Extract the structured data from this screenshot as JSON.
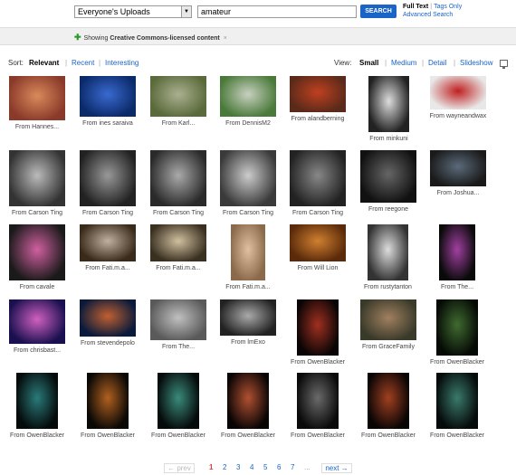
{
  "search": {
    "scope_value": "Everyone's Uploads",
    "query": "amateur",
    "button_label": "SEARCH",
    "mode_full": "Full Text",
    "mode_tags": "Tags Only",
    "advanced": "Advanced Search"
  },
  "cc": {
    "prefix": "Showing",
    "bold": "Creative Commons-licensed content",
    "close": "×"
  },
  "sort": {
    "label": "Sort:",
    "options": [
      "Relevant",
      "Recent",
      "Interesting"
    ]
  },
  "view": {
    "label": "View:",
    "options": [
      "Small",
      "Medium",
      "Detail",
      "Slideshow"
    ]
  },
  "thumbs": [
    {
      "cap": "From Hannes...",
      "c1": "#8a3a2a",
      "c2": "#d98a5a"
    },
    {
      "cap": "From ines saraiva",
      "c1": "#0b2a6a",
      "c2": "#3a6ad0"
    },
    {
      "cap": "From Karl...",
      "c1": "#5a6a3a",
      "c2": "#aab090"
    },
    {
      "cap": "From DennisM2",
      "c1": "#4a7a3a",
      "c2": "#c8d0c0"
    },
    {
      "cap": "From alandberning",
      "c1": "#5a2a1a",
      "c2": "#c04020"
    },
    {
      "cap": "From minkuni",
      "c1": "#222",
      "c2": "#ddd"
    },
    {
      "cap": "From wayneandwax",
      "c1": "#e8e8e8",
      "c2": "#c02020"
    },
    {
      "cap": "From Carson Ting",
      "c1": "#333",
      "c2": "#bbb"
    },
    {
      "cap": "From Carson Ting",
      "c1": "#222",
      "c2": "#999"
    },
    {
      "cap": "From Carson Ting",
      "c1": "#2a2a2a",
      "c2": "#aaa"
    },
    {
      "cap": "From Carson Ting",
      "c1": "#3a3a3a",
      "c2": "#ccc"
    },
    {
      "cap": "From Carson Ting",
      "c1": "#222",
      "c2": "#888"
    },
    {
      "cap": "From reegone",
      "c1": "#111",
      "c2": "#666"
    },
    {
      "cap": "From Joshua...",
      "c1": "#1a1a1a",
      "c2": "#5a6a7a"
    },
    {
      "cap": "From cavale",
      "c1": "#1a1a1a",
      "c2": "#d060a0"
    },
    {
      "cap": "From Fati.m.a...",
      "c1": "#3a2a1a",
      "c2": "#c0b0a0"
    },
    {
      "cap": "From Fati.m.a...",
      "c1": "#3a3020",
      "c2": "#d0c0a0"
    },
    {
      "cap": "From Fati.m.a...",
      "c1": "#8a6a4a",
      "c2": "#e0c0a0"
    },
    {
      "cap": "From Will Lion",
      "c1": "#5a2a0a",
      "c2": "#d08030"
    },
    {
      "cap": "From rustytanton",
      "c1": "#333",
      "c2": "#ddd"
    },
    {
      "cap": "From The...",
      "c1": "#0a0a0a",
      "c2": "#a040a0"
    },
    {
      "cap": "From chrisbast...",
      "c1": "#1a1050",
      "c2": "#d060c0"
    },
    {
      "cap": "From stevendepolo",
      "c1": "#0a1a3a",
      "c2": "#c06030"
    },
    {
      "cap": "From The...",
      "c1": "#5a5a5a",
      "c2": "#c0c0c0"
    },
    {
      "cap": "From lmExo",
      "c1": "#222",
      "c2": "#aaa"
    },
    {
      "cap": "From OwenBlacker",
      "c1": "#0a0505",
      "c2": "#a03020"
    },
    {
      "cap": "From GraceFamily",
      "c1": "#3a3a2a",
      "c2": "#a08060"
    },
    {
      "cap": "From OwenBlacker",
      "c1": "#050a05",
      "c2": "#406a30"
    },
    {
      "cap": "From OwenBlacker",
      "c1": "#050a0a",
      "c2": "#2a7a7a"
    },
    {
      "cap": "From OwenBlacker",
      "c1": "#0a0805",
      "c2": "#b06020"
    },
    {
      "cap": "From OwenBlacker",
      "c1": "#050a0a",
      "c2": "#3a8a7a"
    },
    {
      "cap": "From OwenBlacker",
      "c1": "#0a0505",
      "c2": "#b05030"
    },
    {
      "cap": "From OwenBlacker",
      "c1": "#0a0a0a",
      "c2": "#6a6a6a"
    },
    {
      "cap": "From OwenBlacker",
      "c1": "#0a0505",
      "c2": "#a04020"
    },
    {
      "cap": "From OwenBlacker",
      "c1": "#050a0a",
      "c2": "#3a7a6a"
    }
  ],
  "pager": {
    "prev": "← prev",
    "pages": [
      "1",
      "2",
      "3",
      "4",
      "5",
      "6",
      "7"
    ],
    "dots": "...",
    "next": "next →"
  }
}
